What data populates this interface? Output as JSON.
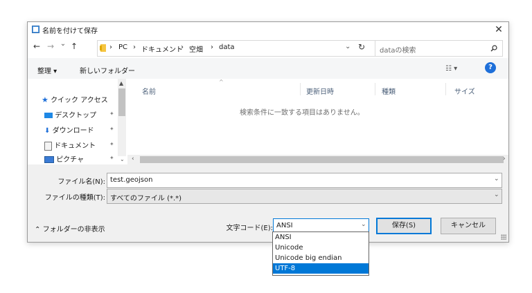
{
  "window": {
    "title": "名前を付けて保存",
    "close_glyph": "✕"
  },
  "nav_buttons": {
    "back": "←",
    "forward": "→",
    "recent": "⌄",
    "up": "↑"
  },
  "breadcrumb": [
    "PC",
    "ドキュメント",
    "空畑",
    "data"
  ],
  "breadcrumb_sep": "›",
  "search": {
    "placeholder": "dataの検索"
  },
  "toolbar": {
    "organize": "整理 ▾",
    "new_folder": "新しいフォルダー",
    "view": "☷ ▾",
    "help": "?"
  },
  "sidebar": {
    "items": [
      {
        "label": "クイック アクセス",
        "icon": "star-icon",
        "pinned": false
      },
      {
        "label": "デスクトップ",
        "icon": "desktop-icon",
        "pinned": true
      },
      {
        "label": "ダウンロード",
        "icon": "download-icon",
        "pinned": true
      },
      {
        "label": "ドキュメント",
        "icon": "document-icon",
        "pinned": true
      },
      {
        "label": "ピクチャ",
        "icon": "picture-icon",
        "pinned": true
      }
    ],
    "pin_glyph": "📌"
  },
  "columns": [
    "名前",
    "更新日時",
    "種類",
    "サイズ"
  ],
  "empty_message": "検索条件に一致する項目はありません。",
  "filename": {
    "label": "ファイル名(N):",
    "value": "test.geojson"
  },
  "filetype": {
    "label": "ファイルの種類(T):",
    "value": "すべてのファイル  (*.*)"
  },
  "hide_folders": "フォルダーの非表示",
  "encoding": {
    "label": "文字コード(E):",
    "value": "ANSI",
    "options": [
      "ANSI",
      "Unicode",
      "Unicode big endian",
      "UTF-8"
    ],
    "highlighted": "UTF-8"
  },
  "buttons": {
    "save": "保存(S)",
    "cancel": "キャンセル"
  },
  "colors": {
    "accent": "#0078d7",
    "folder": "#f5c542",
    "star": "#1e6fd9"
  }
}
